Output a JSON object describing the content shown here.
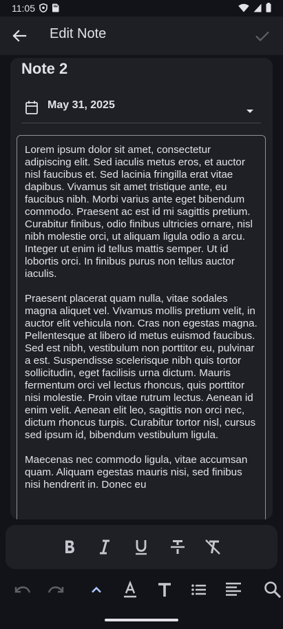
{
  "status": {
    "time": "11:05"
  },
  "appbar": {
    "title": "Edit Note"
  },
  "note": {
    "title": "Note 2",
    "date": "May 31, 2025",
    "paragraphs": [
      "Lorem ipsum dolor sit amet, consectetur adipiscing elit. Sed iaculis metus eros, et auctor nisl faucibus et. Sed lacinia fringilla erat vitae dapibus. Vivamus sit amet tristique ante, eu faucibus nibh. Morbi varius ante eget bibendum commodo. Praesent ac est id mi sagittis pretium. Curabitur finibus, odio finibus ultricies ornare, nisl nibh molestie orci, ut aliquam ligula odio a arcu. Integer ut enim id tellus mattis semper. Ut id lobortis orci. In finibus purus non tellus auctor iaculis.",
      "Praesent placerat quam nulla, vitae sodales magna aliquet vel. Vivamus mollis pretium velit, in auctor elit vehicula non. Cras non egestas magna. Pellentesque at libero id metus euismod faucibus. Sed est nibh, vestibulum non porttitor eu, pulvinar a est. Suspendisse scelerisque nibh quis tortor sollicitudin, eget facilisis urna dictum. Mauris fermentum orci vel lectus rhoncus, quis porttitor nisi molestie. Proin vitae rutrum lectus. Aenean id enim velit. Aenean elit leo, sagittis non orci nec, dictum rhoncus turpis. Curabitur tortor nisl, cursus sed ipsum id, bibendum vestibulum ligula.",
      "Maecenas nec commodo ligula, vitae accumsan quam. Aliquam egestas mauris nisi, sed finibus nisi hendrerit in. Donec eu"
    ]
  },
  "icons": {
    "status_left": [
      "shield-icon",
      "sim-icon"
    ],
    "status_right": [
      "wifi-icon",
      "signal-icon",
      "battery-icon"
    ],
    "format": [
      "bold-icon",
      "italic-icon",
      "underline-icon",
      "strikethrough-icon",
      "clear-format-icon"
    ],
    "toolbar": [
      "undo-icon",
      "redo-icon",
      "collapse-icon",
      "text-color-icon",
      "font-size-icon",
      "list-icon",
      "align-icon",
      "search-icon"
    ]
  },
  "colors": {
    "background": "#121318",
    "surface": "#1e2026",
    "appbar": "#1d1f25",
    "text": "#e3e2e9",
    "accent": "#adc6ff",
    "disabled": "#5f6169"
  }
}
